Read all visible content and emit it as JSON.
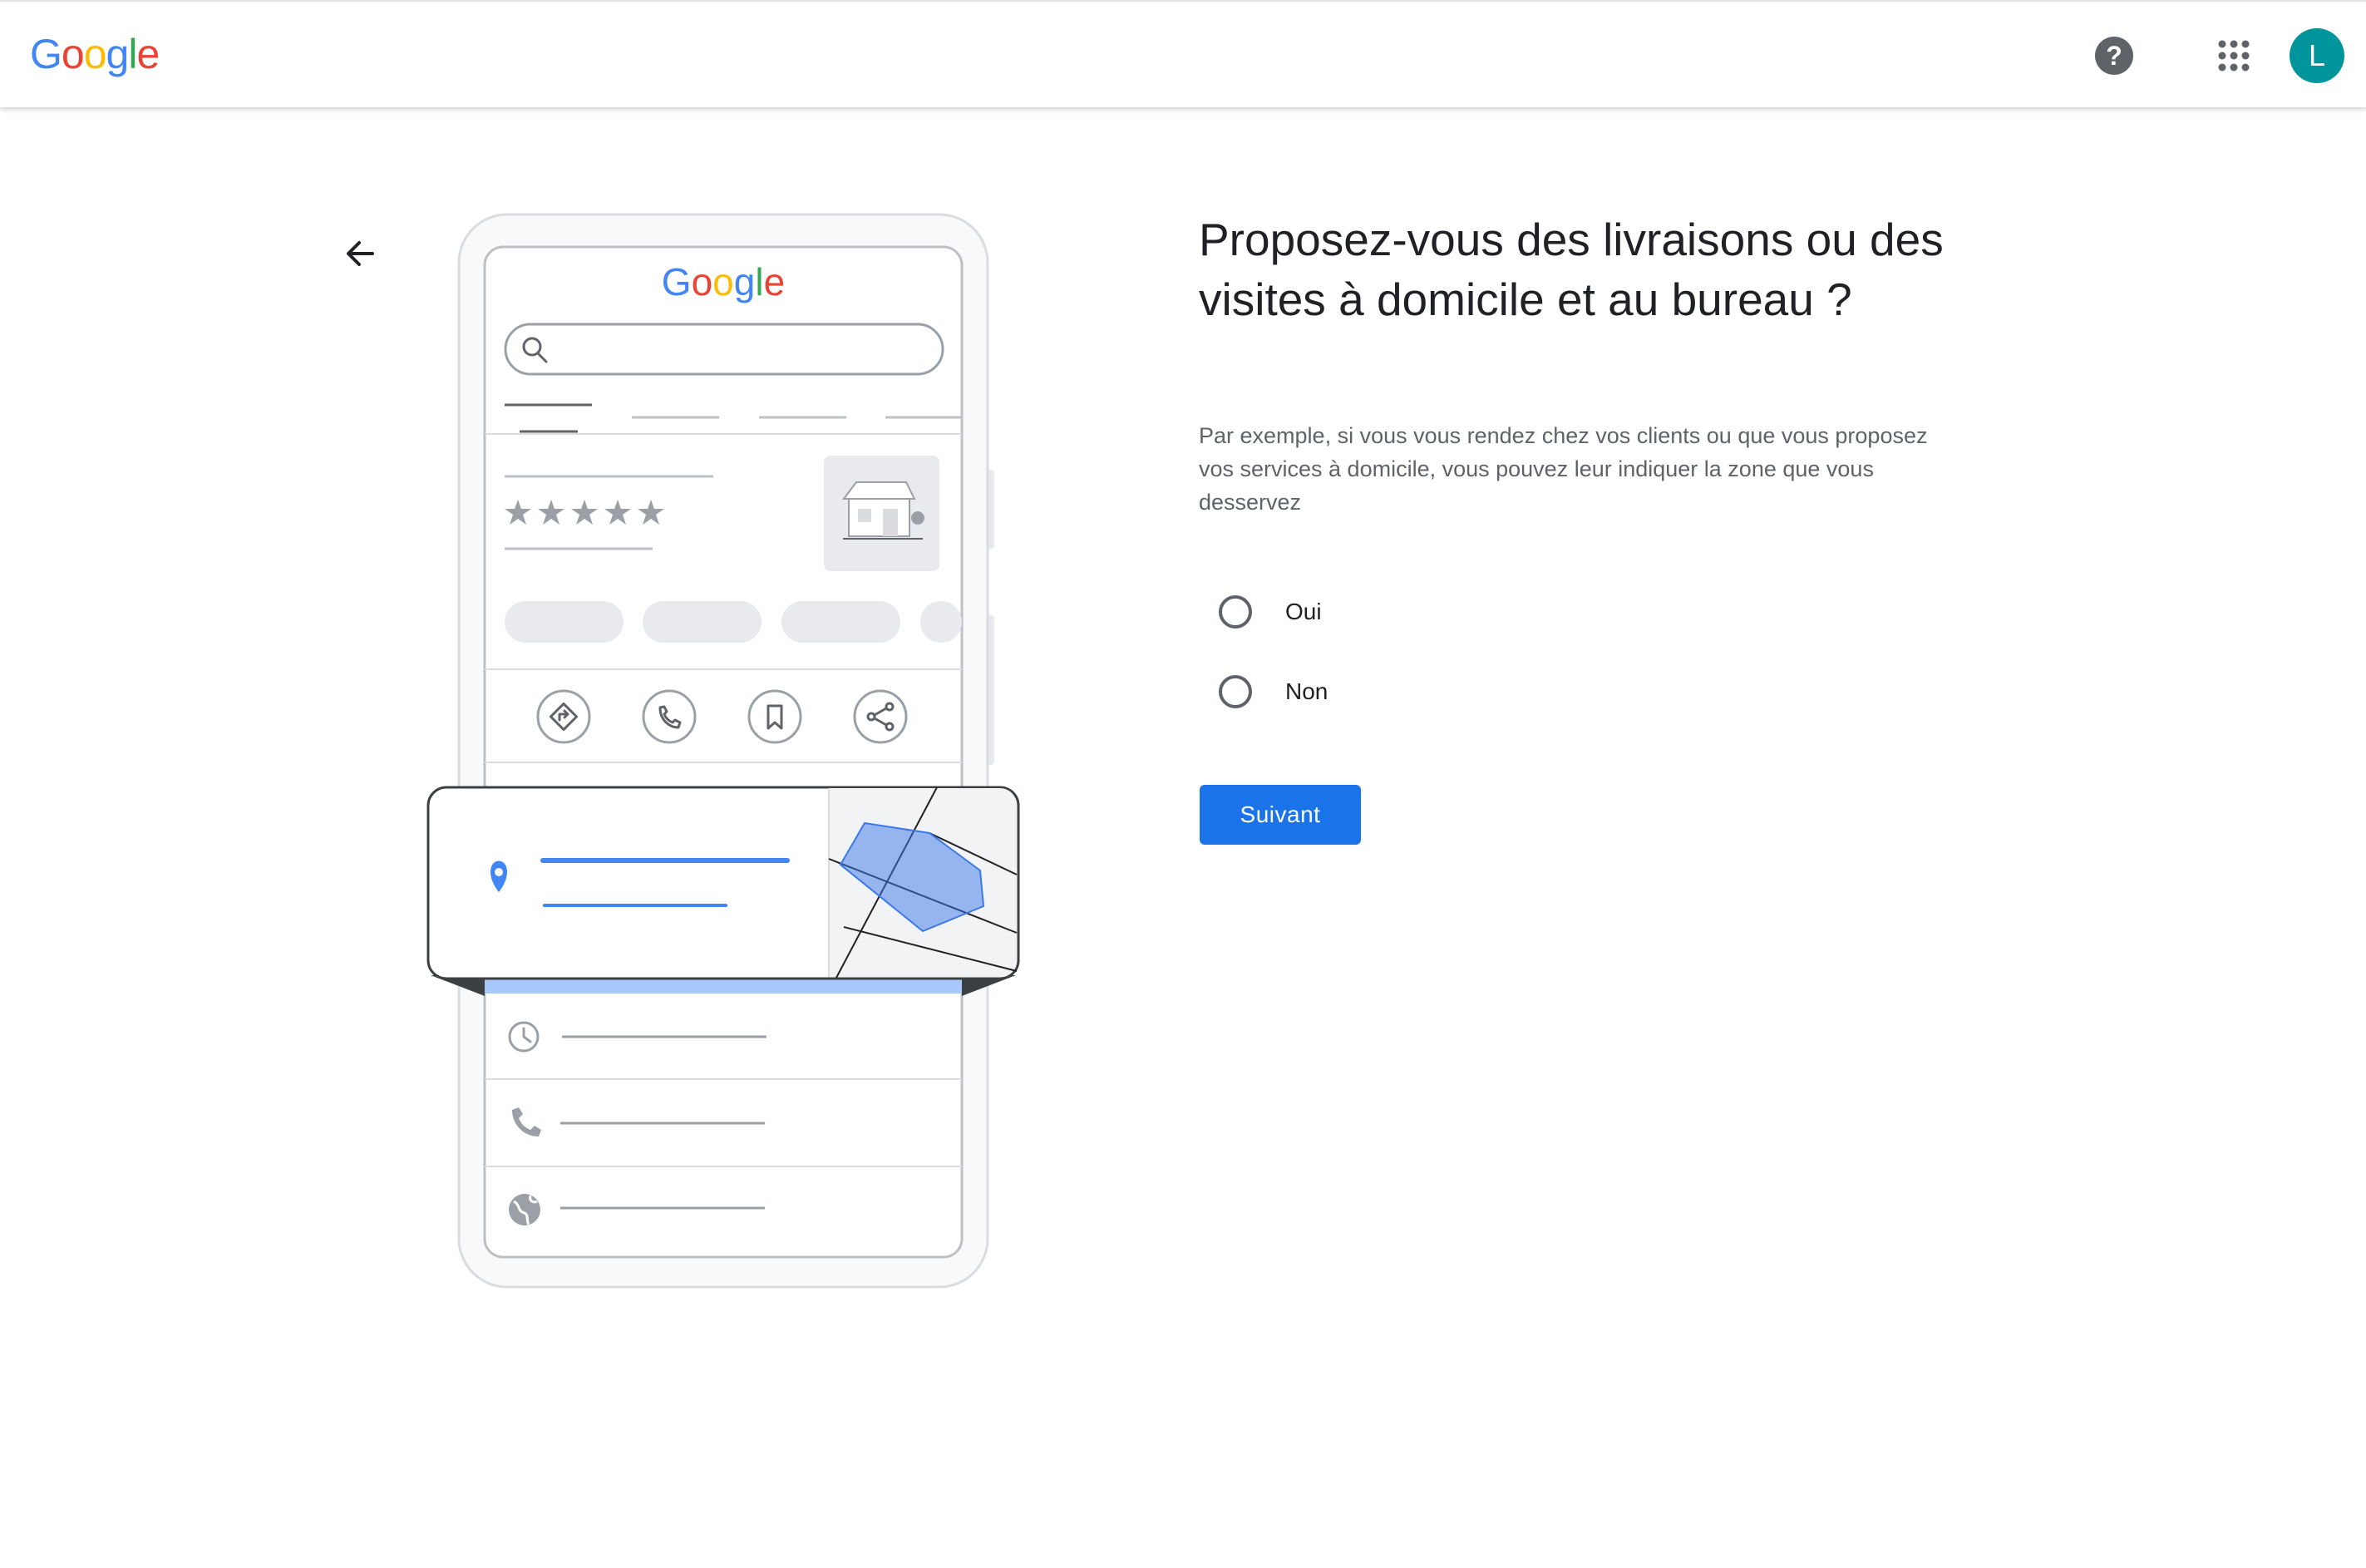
{
  "header": {
    "logo_letters": [
      {
        "char": "G",
        "color": "#4285f4"
      },
      {
        "char": "o",
        "color": "#ea4335"
      },
      {
        "char": "o",
        "color": "#fbbc05"
      },
      {
        "char": "g",
        "color": "#4285f4"
      },
      {
        "char": "l",
        "color": "#34a853"
      },
      {
        "char": "e",
        "color": "#ea4335"
      }
    ],
    "help_icon": "help-circle-icon",
    "help_glyph": "?",
    "apps_icon": "apps-grid-icon",
    "avatar_initial": "L",
    "avatar_color": "#00949c"
  },
  "nav": {
    "back_icon": "arrow-back-icon"
  },
  "illustration": {
    "logo_text": "Google",
    "rating_stars": 5
  },
  "question": {
    "title": "Proposez-vous des livraisons ou des visites à domicile et au bureau ?",
    "description": "Par exemple, si vous vous rendez chez vos clients ou que vous proposez vos services à domicile, vous pouvez leur indiquer la zone que vous desservez",
    "options": [
      {
        "label": "Oui",
        "selected": false
      },
      {
        "label": "Non",
        "selected": false
      }
    ]
  },
  "actions": {
    "next_label": "Suivant",
    "primary_color": "#1a73e8"
  }
}
